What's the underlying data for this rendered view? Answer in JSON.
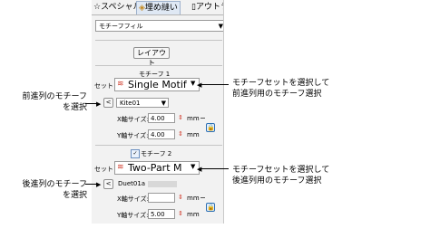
{
  "tabs": [
    {
      "icon": "star-icon",
      "label": "スペシャル"
    },
    {
      "icon": "fill-icon",
      "label": "埋め縫い"
    },
    {
      "icon": "outline-icon",
      "label": "アウトラ"
    }
  ],
  "fill_type": "モチーフフィル",
  "layout_button": "レイアウト",
  "motif1": {
    "title": "モチーフ 1",
    "set_label": "セット",
    "set_value": "Single Motif",
    "motif_value": "Kite01",
    "x_label": "X軸サイズ:",
    "x_value": "4.00",
    "y_label": "Y軸サイズ:",
    "y_value": "4.00",
    "unit": "mm"
  },
  "motif2": {
    "checkbox_checked": true,
    "title": "モチーフ 2",
    "set_label": "セット",
    "set_value": "Two-Part M",
    "motif_value": "Duet01a",
    "x_label": "X軸サイズ:",
    "x_value": "",
    "y_label": "Y軸サイズ:",
    "y_value": "5.00",
    "unit": "mm"
  },
  "annotations": {
    "right1_line1": "モチーフセットを選択して",
    "right1_line2": "前進列用のモチーフ選択",
    "left1_line1": "前進列のモチーフ",
    "left1_line2": "を選択",
    "right2_line1": "モチーフセットを選択して",
    "right2_line2": "後進列用のモチーフ選択",
    "left2_line1": "後進列のモチーフ",
    "left2_line2": "を選択"
  },
  "colors": {
    "accent_red": "#d03a2a",
    "lock_blue": "#2b6fb3",
    "panel_bg": "#f2f2f2"
  }
}
